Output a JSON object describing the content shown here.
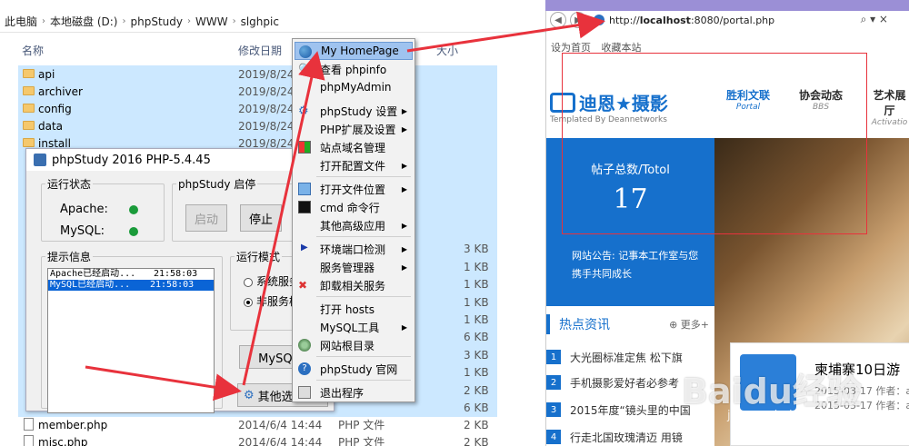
{
  "breadcrumb": [
    "此电脑",
    "本地磁盘 (D:)",
    "phpStudy",
    "WWW",
    "slghpic"
  ],
  "columns": {
    "name": "名称",
    "date": "修改日期",
    "size": "大小"
  },
  "folders": [
    {
      "name": "api",
      "date": "2019/8/24"
    },
    {
      "name": "archiver",
      "date": "2019/8/24"
    },
    {
      "name": "config",
      "date": "2019/8/24"
    },
    {
      "name": "data",
      "date": "2019/8/24"
    },
    {
      "name": "install",
      "date": "2019/8/24"
    }
  ],
  "sizes": [
    "3 KB",
    "1 KB",
    "1 KB",
    "1 KB",
    "1 KB",
    "6 KB",
    "3 KB",
    "1 KB",
    "2 KB",
    "6 KB"
  ],
  "files": [
    {
      "name": "member.php",
      "date": "2014/6/4 14:44",
      "type": "PHP 文件",
      "size": "2 KB"
    },
    {
      "name": "misc.php",
      "date": "2014/6/4 14:44",
      "type": "PHP 文件",
      "size": "2 KB"
    }
  ],
  "phpstudy": {
    "title": "phpStudy 2016   PHP-5.4.45",
    "status_legend": "运行状态",
    "apache": "Apache:",
    "mysql": "MySQL:",
    "start_legend": "phpStudy 启停",
    "start_btn": "启动",
    "stop_btn": "停止",
    "info_legend": "提示信息",
    "log": [
      {
        "msg": "Apache已经启动...",
        "time": "21:58:03"
      },
      {
        "msg": "MySQL已经启动...",
        "time": "21:58:03"
      }
    ],
    "mode_legend": "运行模式",
    "mode1": "系统服务",
    "mode2": "非服务模",
    "mysql_btn": "MySQL管",
    "other_btn": "其他选"
  },
  "menu": [
    {
      "label": "My HomePage",
      "icon": "globe-icon",
      "sub": false
    },
    {
      "label": "查看 phpinfo",
      "icon": "search-icon",
      "sub": false
    },
    {
      "label": "phpMyAdmin",
      "icon": "",
      "sub": false
    },
    {
      "label": "phpStudy 设置",
      "icon": "gear-icon",
      "sub": true
    },
    {
      "label": "PHP扩展及设置",
      "icon": "",
      "sub": true
    },
    {
      "label": "站点域名管理",
      "icon": "grid-icon",
      "sub": false
    },
    {
      "label": "打开配置文件",
      "icon": "",
      "sub": true
    },
    {
      "label": "打开文件位置",
      "icon": "folder-icon",
      "sub": true
    },
    {
      "label": "cmd 命令行",
      "icon": "terminal-icon",
      "sub": false
    },
    {
      "label": "其他高级应用",
      "icon": "",
      "sub": true
    },
    {
      "label": "环境端口检测",
      "icon": "play-icon",
      "sub": true
    },
    {
      "label": "服务管理器",
      "icon": "",
      "sub": true
    },
    {
      "label": "卸载相关服务",
      "icon": "wrench-icon",
      "sub": false
    },
    {
      "label": "打开 hosts",
      "icon": "",
      "sub": false
    },
    {
      "label": "MySQL工具",
      "icon": "",
      "sub": true
    },
    {
      "label": "网站根目录",
      "icon": "disk-icon",
      "sub": false
    },
    {
      "label": "phpStudy 官网",
      "icon": "help-icon",
      "sub": false
    },
    {
      "label": "退出程序",
      "icon": "exit-icon",
      "sub": false
    }
  ],
  "browser": {
    "url_prefix": "http://",
    "url_host": "localhost",
    "url_rest": ":8080/portal.php",
    "bookmarks": [
      "设为首页",
      "收藏本站"
    ],
    "logo_text": "迪恩★摄影",
    "logo_sub": "Templated By Deannetworks",
    "nav": [
      {
        "cn": "胜利文联",
        "en": "Portal"
      },
      {
        "cn": "协会动态",
        "en": "BBS"
      },
      {
        "cn": "艺术展厅",
        "en": "Activatio"
      }
    ],
    "stats_label": "帖子总数/Totol",
    "stats_value": "17",
    "notice": "网站公告: 记事本工作室与您携手共同成长",
    "hot_title": "热点资讯",
    "more": "更多+",
    "hot_items": [
      "大光圈标准定焦 松下旗",
      "手机摄影爱好者必参考",
      "2015年度“镜头里的中国",
      "行走北国玫瑰清迈 用镜"
    ],
    "card_title": "柬埔寨10日游",
    "card_meta1": "2015-03-17 作者：a",
    "card_meta2": "2015-03-17 作者：a"
  },
  "watermark": "Baidu经验",
  "watermark_url": "jingyan.baidu.com",
  "colors": {
    "accent": "#1670cc",
    "annotation": "#e8323c",
    "selection": "#cce8ff"
  }
}
